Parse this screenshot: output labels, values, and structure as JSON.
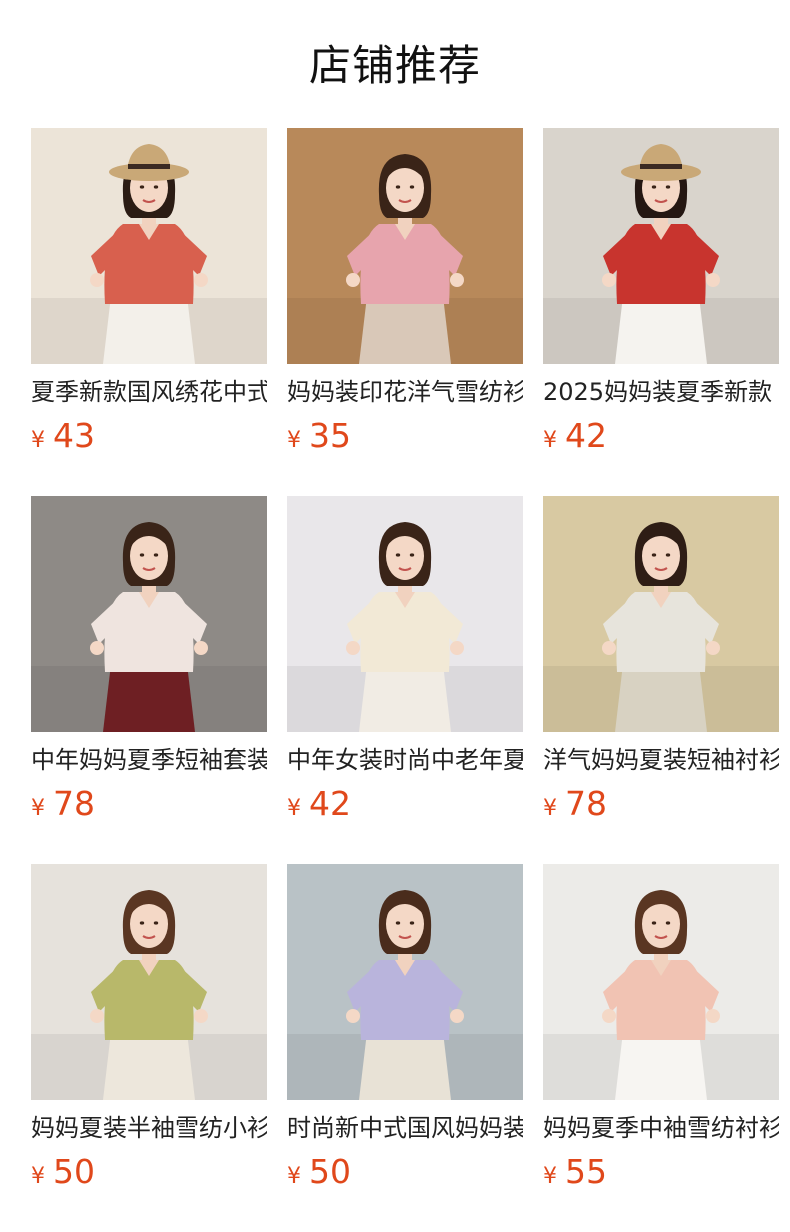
{
  "header": {
    "title": "店铺推荐"
  },
  "colors": {
    "price": "#e0481b",
    "title": "#111111",
    "name": "#222222"
  },
  "products": [
    {
      "name": "夏季新款国风绣花中式",
      "currency": "¥",
      "price": "43",
      "image": {
        "icon": "garment-photo",
        "bg": "#ece4d8",
        "top": "#d8604e",
        "bottom": "#f3f0ea",
        "hair": "#2b1c14",
        "hat": true
      }
    },
    {
      "name": "妈妈装印花洋气雪纺衫",
      "currency": "¥",
      "price": "35",
      "image": {
        "icon": "garment-photo",
        "bg": "#b8895a",
        "top": "#e7a4ad",
        "bottom": "#d9c8b8",
        "hair": "#3a2418",
        "hat": false
      }
    },
    {
      "name": "2025妈妈装夏季新款",
      "currency": "¥",
      "price": "42",
      "image": {
        "icon": "garment-photo",
        "bg": "#d9d4cc",
        "top": "#c8342e",
        "bottom": "#f5f3ef",
        "hair": "#241712",
        "hat": true
      }
    },
    {
      "name": "中年妈妈夏季短袖套装",
      "currency": "¥",
      "price": "78",
      "image": {
        "icon": "garment-photo",
        "bg": "#8e8a86",
        "top": "#efe4df",
        "bottom": "#6e1f23",
        "hair": "#3a2418",
        "hat": false
      }
    },
    {
      "name": "中年女装时尚中老年夏",
      "currency": "¥",
      "price": "42",
      "image": {
        "icon": "garment-photo",
        "bg": "#e9e7ea",
        "top": "#f2e9d6",
        "bottom": "#f1ece4",
        "hair": "#3a2418",
        "hat": false
      }
    },
    {
      "name": "洋气妈妈夏装短袖衬衫",
      "currency": "¥",
      "price": "78",
      "image": {
        "icon": "garment-photo",
        "bg": "#d8c9a2",
        "top": "#e7e4dc",
        "bottom": "#d8d2c2",
        "hair": "#2e1d15",
        "hat": false
      }
    },
    {
      "name": "妈妈夏装半袖雪纺小衫",
      "currency": "¥",
      "price": "50",
      "image": {
        "icon": "garment-photo",
        "bg": "#e6e2dc",
        "top": "#b8b86a",
        "bottom": "#ede7dc",
        "hair": "#5a3622",
        "hat": false
      }
    },
    {
      "name": "时尚新中式国风妈妈装",
      "currency": "¥",
      "price": "50",
      "image": {
        "icon": "garment-photo",
        "bg": "#b9c2c6",
        "top": "#b9b4dc",
        "bottom": "#e8e2d6",
        "hair": "#4a2c1c",
        "hat": false
      }
    },
    {
      "name": "妈妈夏季中袖雪纺衬衫",
      "currency": "¥",
      "price": "55",
      "image": {
        "icon": "garment-photo",
        "bg": "#ecebe8",
        "top": "#f1c3b3",
        "bottom": "#f7f5f2",
        "hair": "#5a3622",
        "hat": false
      }
    }
  ]
}
